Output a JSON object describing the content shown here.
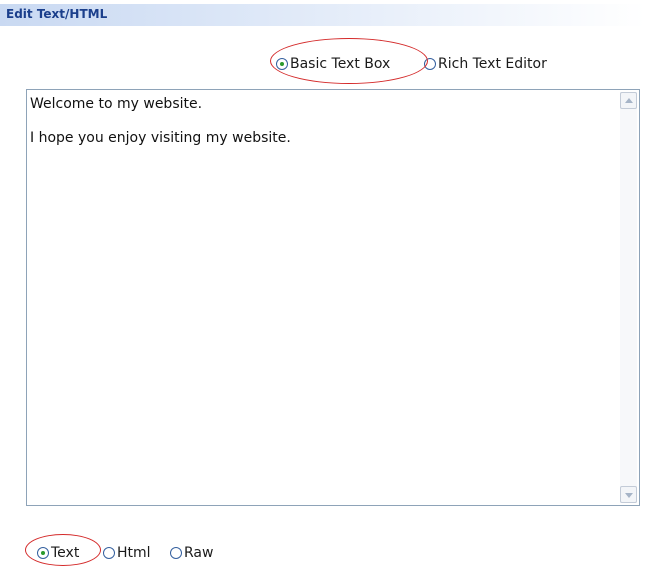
{
  "header": {
    "title": "Edit Text/HTML"
  },
  "editor_mode": {
    "options": [
      {
        "label": "Basic Text Box",
        "checked": true
      },
      {
        "label": "Rich Text Editor",
        "checked": false
      }
    ]
  },
  "editor": {
    "lines": [
      "Welcome to my website.",
      "I hope you enjoy visiting my website."
    ]
  },
  "format": {
    "options": [
      {
        "label": "Text",
        "checked": true
      },
      {
        "label": "Html",
        "checked": false
      },
      {
        "label": "Raw",
        "checked": false
      }
    ]
  },
  "annotation_color": "#d42a2a"
}
